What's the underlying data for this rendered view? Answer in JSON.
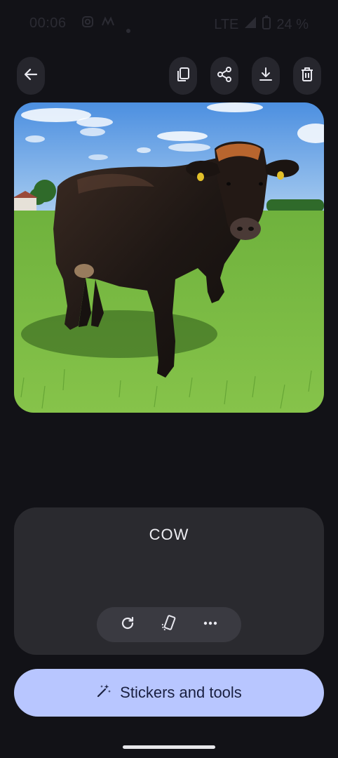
{
  "status": {
    "time": "00:06",
    "network": "LTE",
    "battery": "24 %"
  },
  "toolbar": {
    "back_icon": "arrow-left-icon",
    "copy_icon": "copy-icon",
    "share_icon": "share-icon",
    "download_icon": "download-icon",
    "delete_icon": "trash-icon"
  },
  "caption": {
    "label": "COW"
  },
  "tools": {
    "items": [
      "refresh-icon",
      "rotate-icon",
      "more-icon"
    ]
  },
  "cta": {
    "label": "Stickers and tools",
    "icon": "magic-wand-icon"
  },
  "colors": {
    "background": "#121217",
    "panel": "#2a2a2f",
    "cta": "#b8c6ff"
  }
}
